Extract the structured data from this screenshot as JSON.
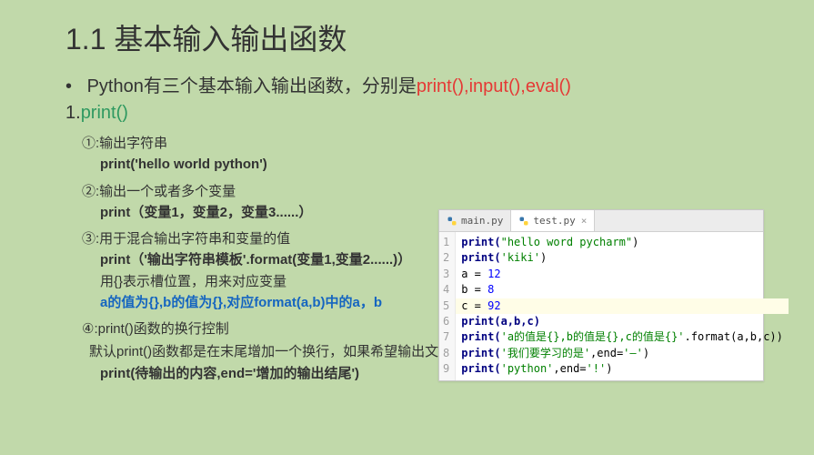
{
  "title": "1.1 基本输入输出函数",
  "intro_prefix": "Python有三个基本输入输出函数，分别是",
  "intro_funcs": "print(),input(),eval()",
  "subhead_num": "1.",
  "subhead_func": "print()",
  "items": {
    "i1_label": "①:输出字符串",
    "i1_code": "print('hello world python')",
    "i2_label": "②:输出一个或者多个变量",
    "i2_code": "print（变量1，变量2，变量3......）",
    "i3_label": "③:用于混合输出字符串和变量的值",
    "i3_code": "print（'输出字符串模板'.format(变量1,变量2......)）",
    "i3_note": "用{}表示槽位置，用来对应变量",
    "i3_blue": "a的值为{},b的值为{},对应format(a,b)中的a，b",
    "i4_label": "④:print()函数的换行控制",
    "i4_desc": "默认print()函数都是在末尾增加一个换行，如果希望输出文本最后增加其他内容",
    "i4_code": "print(待输出的内容,end='增加的输出结尾')"
  },
  "editor": {
    "tab1": "main.py",
    "tab2": "test.py",
    "lines": {
      "l1_a": "print(",
      "l1_b": "\"hello word pycharm\"",
      "l1_c": ")",
      "l2_a": "print(",
      "l2_b": "'kiki'",
      "l2_c": ")",
      "l3_a": "a = ",
      "l3_b": "12",
      "l4_a": "b = ",
      "l4_b": "8",
      "l5_a": "c = ",
      "l5_b": "92",
      "l6": "print(a,b,c)",
      "l7_a": "print(",
      "l7_b": "'a的值是{},b的值是{},c的值是{}'",
      "l7_c": ".format(a,b,c))",
      "l8_a": "print(",
      "l8_b": "'我们要学习的是'",
      "l8_c": ",end=",
      "l8_d": "'—'",
      "l8_e": ")",
      "l9_a": "print(",
      "l9_b": "'python'",
      "l9_c": ",end=",
      "l9_d": "'!'",
      "l9_e": ")"
    },
    "gutter": [
      "1",
      "2",
      "3",
      "4",
      "5",
      "6",
      "7",
      "8",
      "9"
    ]
  }
}
